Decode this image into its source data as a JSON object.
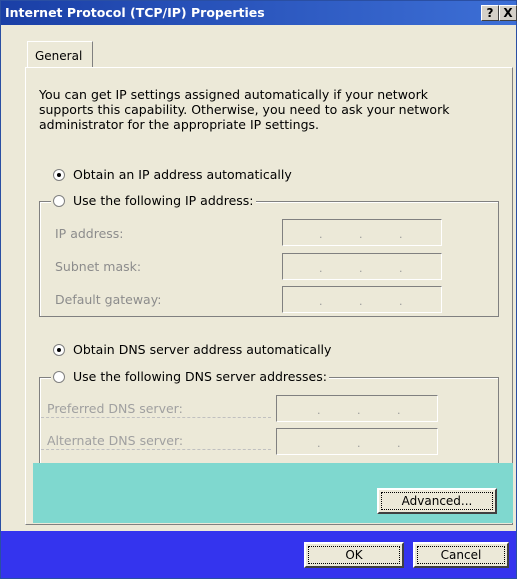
{
  "window": {
    "title": "Internet Protocol (TCP/IP) Properties",
    "help_button": "?",
    "close_button": "X"
  },
  "tabs": [
    {
      "label": "General"
    }
  ],
  "description": "You can get IP settings assigned automatically if your network supports this capability. Otherwise, you need to ask your network administrator for the appropriate IP settings.",
  "ip_options": {
    "auto": {
      "label": "Obtain an IP address automatically",
      "checked": true
    },
    "manual": {
      "label": "Use the following IP address:",
      "checked": false
    }
  },
  "ip_fields": [
    {
      "label": "IP address:",
      "value": ". . ."
    },
    {
      "label": "Subnet mask:",
      "value": ". . ."
    },
    {
      "label": "Default gateway:",
      "value": ". . ."
    }
  ],
  "dns_options": {
    "auto": {
      "label": "Obtain DNS server address automatically",
      "checked": true
    },
    "manual": {
      "label": "Use the following DNS server addresses:",
      "checked": false
    }
  },
  "dns_fields": [
    {
      "label": "Preferred DNS server:",
      "value": ". . ."
    },
    {
      "label": "Alternate DNS server:",
      "value": ". . ."
    }
  ],
  "buttons": {
    "advanced": "Advanced...",
    "ok": "OK",
    "cancel": "Cancel"
  },
  "colors": {
    "titlebar": "#1a3fa6",
    "dialog_bg": "#ece9d8",
    "cyan_artifact": "#7fd8cf",
    "footer_artifact": "#3434ee"
  }
}
